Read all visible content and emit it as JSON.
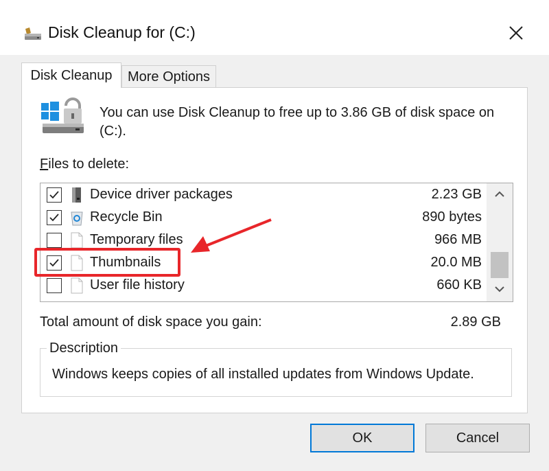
{
  "window": {
    "title": "Disk Cleanup for  (C:)",
    "title_icon": "drive-cleanup-icon",
    "close_icon": "close-icon"
  },
  "tabs": [
    {
      "label": "Disk Cleanup",
      "active": true
    },
    {
      "label": "More Options",
      "active": false
    }
  ],
  "intro": {
    "icon": "windows-drive-lock-icon",
    "text": "You can use Disk Cleanup to free up to 3.86 GB of disk space on (C:)."
  },
  "files": {
    "label_underlined": "F",
    "label_rest": "iles to delete:",
    "items": [
      {
        "name": "Device driver packages",
        "size": "2.23 GB",
        "checked": true,
        "icon": "driver-package-icon"
      },
      {
        "name": "Recycle Bin",
        "size": "890 bytes",
        "checked": true,
        "icon": "recycle-bin-icon"
      },
      {
        "name": "Temporary files",
        "size": "966 MB",
        "checked": false,
        "icon": "file-icon"
      },
      {
        "name": "Thumbnails",
        "size": "20.0 MB",
        "checked": true,
        "icon": "file-icon"
      },
      {
        "name": "User file history",
        "size": "660 KB",
        "checked": false,
        "icon": "file-icon"
      }
    ]
  },
  "total": {
    "label": "Total amount of disk space you gain:",
    "value": "2.89 GB"
  },
  "description": {
    "legend": "Description",
    "text": "Windows keeps copies of all installed updates from Windows Update."
  },
  "buttons": {
    "ok": "OK",
    "cancel": "Cancel"
  },
  "annotation": {
    "highlight_color": "#e8262a",
    "target": "Thumbnails"
  }
}
